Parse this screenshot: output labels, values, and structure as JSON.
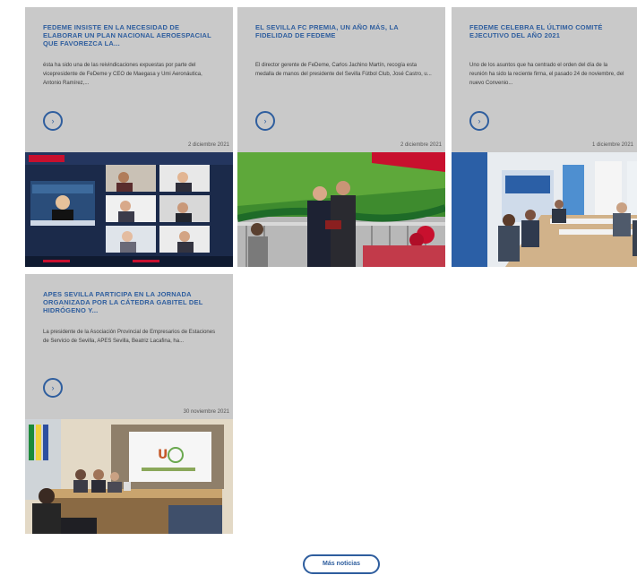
{
  "news": [
    {
      "title": "FEDEME INSISTE EN LA NECESIDAD DE ELABORAR UN PLAN NACIONAL AEROESPACIAL QUE FAVOREZCA LA...",
      "excerpt": "ésta ha sido una de las reivindicaciones expuestas por parte del vicepresidente de FeDeme y CEO de Maegasa y Umi Aeronáutica, Antonio Ramírez,...",
      "arrow": "›",
      "date": "2 diciembre 2021"
    },
    {
      "title": "EL SEVILLA FC PREMIA, UN AÑO MÁS, LA FIDELIDAD DE FEDEME",
      "excerpt": "El director gerente de FeDeme, Carlos Jachino Martín, recogía esta medalla de manos del presidente del Sevilla Fútbol Club, José Castro, u...",
      "arrow": "›",
      "date": "2 diciembre 2021"
    },
    {
      "title": "FEDEME CELEBRA EL ÚLTIMO COMITÉ EJECUTIVO DEL AÑO 2021",
      "excerpt": "Uno de los asuntos que ha centrado el orden del día de la reunión ha sido la reciente firma, el pasado 24 de noviembre, del nuevo Convenio...",
      "arrow": "›",
      "date": "1 diciembre 2021"
    },
    {
      "title": "APES SEVILLA PARTICIPA EN LA JORNADA ORGANIZADA POR LA CÁTEDRA GABITEL DEL HIDRÓGENO Y...",
      "excerpt": "La presidente de la Asociación Provincial de Empresarios de Estaciones de Servicio de Sevilla, APES Sevilla, Beatriz Lacafina, ha...",
      "arrow": "›",
      "date": "30 noviembre 2021"
    }
  ],
  "more_label": "Más noticias",
  "colors": {
    "accent": "#2f5e9e",
    "card_bg": "#c9c9c9"
  }
}
